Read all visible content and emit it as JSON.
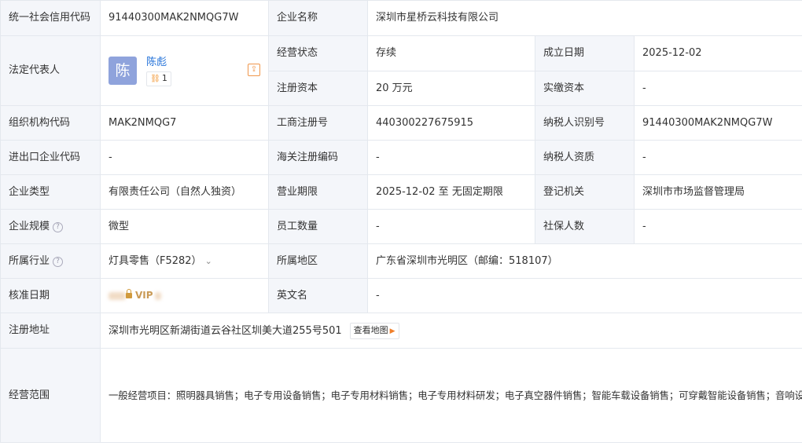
{
  "row1": {
    "l1": "统一社会信用代码",
    "v1": "91440300MAK2NMQG7W",
    "l2": "企业名称",
    "v2": "深圳市星桥云科技有限公司"
  },
  "legal": {
    "label": "法定代表人",
    "avatar_char": "陈",
    "name": "陈彪",
    "count": "1"
  },
  "status": {
    "label": "经营状态",
    "value": "存续",
    "est_label": "成立日期",
    "est_value": "2025-12-02"
  },
  "capital": {
    "label": "注册资本",
    "value": "20 万元",
    "paid_label": "实缴资本",
    "paid_value": "-"
  },
  "row4": {
    "l1": "组织机构代码",
    "v1": "MAK2NMQG7",
    "l2": "工商注册号",
    "v2": "440300227675915",
    "l3": "纳税人识别号",
    "v3": "91440300MAK2NMQG7W"
  },
  "row5": {
    "l1": "进出口企业代码",
    "v1": "-",
    "l2": "海关注册编码",
    "v2": "-",
    "l3": "纳税人资质",
    "v3": "-"
  },
  "row6": {
    "l1": "企业类型",
    "v1": "有限责任公司（自然人独资）",
    "l2": "营业期限",
    "v2": "2025-12-02 至 无固定期限",
    "l3": "登记机关",
    "v3": "深圳市市场监督管理局"
  },
  "row7": {
    "l1": "企业规模",
    "v1": "微型",
    "l2": "员工数量",
    "v2": "-",
    "l3": "社保人数",
    "v3": "-"
  },
  "row8": {
    "l1": "所属行业",
    "v1": "灯具零售（F5282）",
    "l2": "所属地区",
    "v2": "广东省深圳市光明区（邮编：518107）"
  },
  "row9": {
    "l1": "核准日期",
    "vip": "VIP",
    "l2": "英文名",
    "v2": "-"
  },
  "address": {
    "label": "注册地址",
    "value": "深圳市光明区新湖街道云谷社区圳美大道255号501",
    "map_btn": "查看地图"
  },
  "scope": {
    "label": "经营范围",
    "value": "一般经营项目：照明器具销售；电子专用设备销售；电子专用材料销售；电子专用材料研发；电子真空器件销售；智能车载设备销售；可穿戴智能设备销售；音响设备销售；智能家庭消费设备销售；智能机器人销售；显示器件销售；汽车装饰用品销售；汽车零配件零售；汽车零配件批发；货物进出口；技术进出口；国内贸易代理；技术服务、技术开发、技术咨询、技术交流、技术转让、技术推广；电力电子元器件销售；电子元器件零售。（除依法须经批准的项目外，凭营业执照依法自主开展经营活动）许可经营项目：在线数据处理与交易处理业务（经营类电子商务）。（依法须经批准的项目，经相关部门批准后方可开展经营活动，具体经营项目以相关部门批准文件或许可证件为准）"
  }
}
